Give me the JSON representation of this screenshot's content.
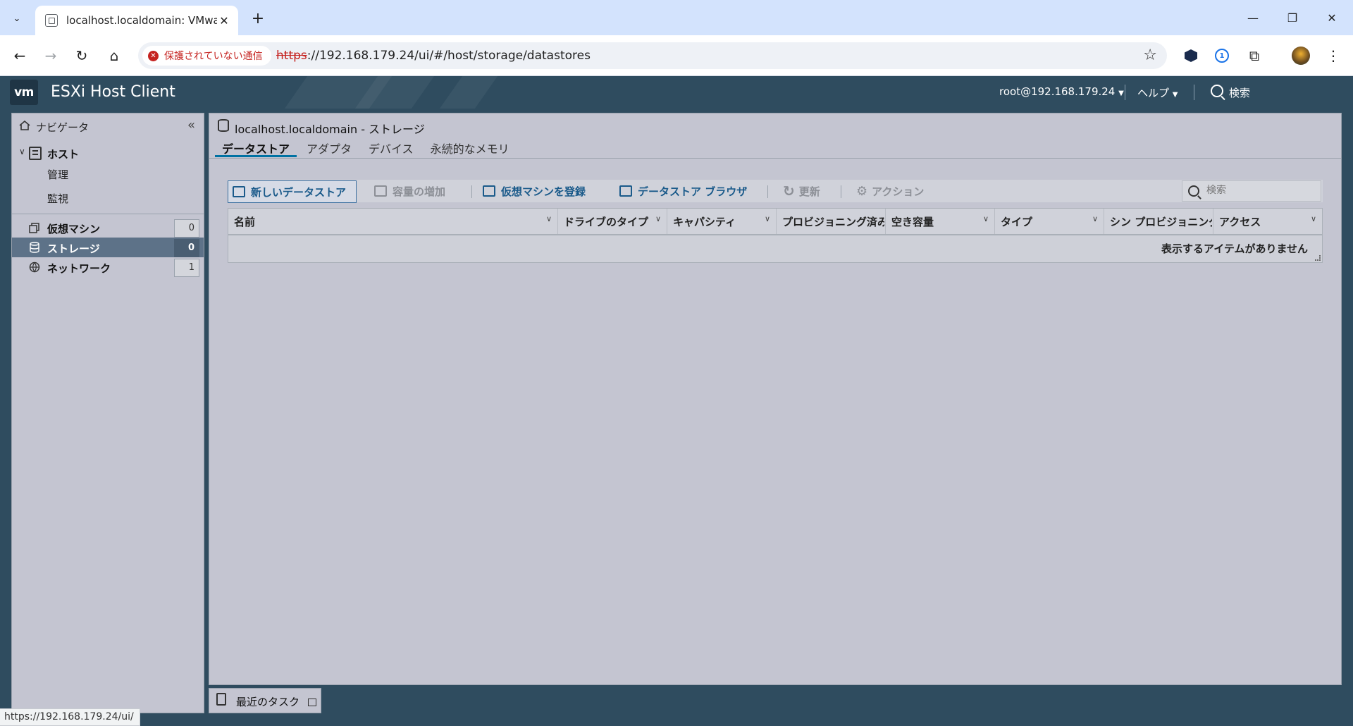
{
  "browser": {
    "tab_title": "localhost.localdomain: VMware",
    "security_label": "保護されていない通信",
    "url_scheme": "https",
    "url_rest": "://192.168.179.24/ui/#/host/storage/datastores",
    "status_bar_url": "https://192.168.179.24/ui/"
  },
  "header": {
    "logo": "vm",
    "app_title": "ESXi Host Client",
    "user": "root@192.168.179.24",
    "help": "ヘルプ",
    "search": "検索"
  },
  "navigator": {
    "title": "ナビゲータ",
    "host": {
      "label": "ホスト",
      "children": [
        "管理",
        "監視"
      ]
    },
    "items": [
      {
        "label": "仮想マシン",
        "count": "0",
        "icon": "vm-icon"
      },
      {
        "label": "ストレージ",
        "count": "0",
        "icon": "storage-icon",
        "selected": true
      },
      {
        "label": "ネットワーク",
        "count": "1",
        "icon": "network-icon"
      }
    ]
  },
  "main": {
    "title": "localhost.localdomain - ストレージ",
    "tabs": [
      {
        "label": "データストア",
        "active": true
      },
      {
        "label": "アダプタ"
      },
      {
        "label": "デバイス"
      },
      {
        "label": "永続的なメモリ"
      }
    ],
    "actions": {
      "new_datastore": "新しいデータストア",
      "increase_capacity": "容量の増加",
      "register_vm": "仮想マシンを登録",
      "datastore_browser": "データストア ブラウザ",
      "refresh": "更新",
      "actions": "アクション"
    },
    "search_placeholder": "検索",
    "columns": [
      "名前",
      "ドライブのタイプ",
      "キャパシティ",
      "プロビジョニング済み",
      "空き容量",
      "タイプ",
      "シン プロビジョニング",
      "アクセス"
    ],
    "empty_message": "表示するアイテムがありません"
  },
  "recent_tasks": "最近のタスク"
}
